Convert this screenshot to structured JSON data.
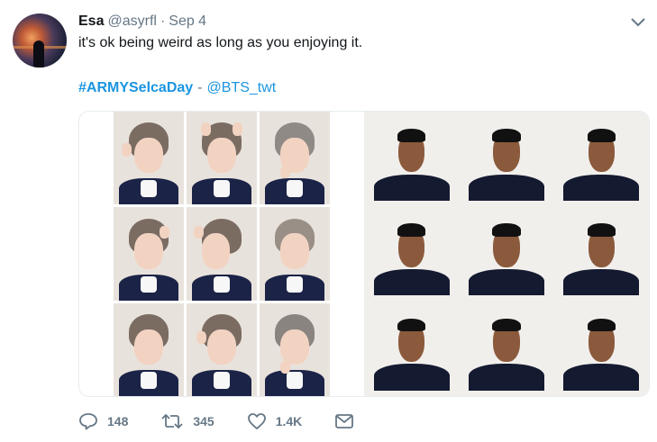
{
  "tweet": {
    "display_name": "Esa",
    "handle": "@asyrfl",
    "separator": "·",
    "date": "Sep 4",
    "text": "it's ok being weird as long as you enjoying it.",
    "hashtag": "#ARMYSelcaDay",
    "dash": "-",
    "mention": "@BTS_twt"
  },
  "actions": {
    "replies": "148",
    "retweets": "345",
    "likes": "1.4K"
  },
  "colors": {
    "link": "#1b95e0",
    "secondary_text": "#657786"
  },
  "icons": [
    "chevron-down-icon",
    "reply-icon",
    "retweet-icon",
    "like-icon",
    "dm-icon"
  ]
}
